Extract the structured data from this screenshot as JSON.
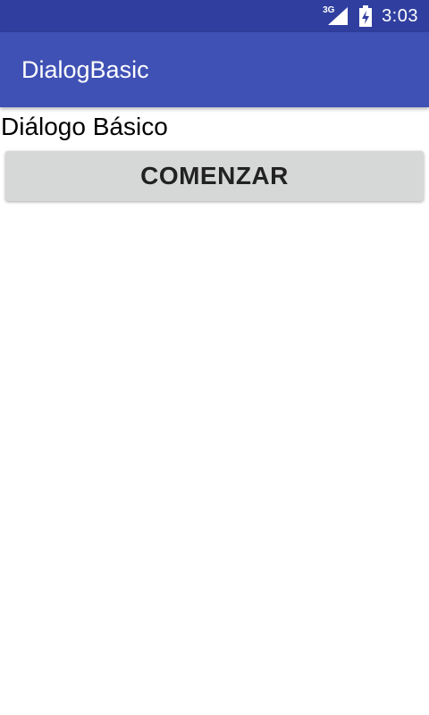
{
  "status_bar": {
    "network_type": "3G",
    "time": "3:03",
    "icons": [
      "signal-icon",
      "battery-charging-icon"
    ],
    "background_color": "#303F9F"
  },
  "app_bar": {
    "title": "DialogBasic",
    "background_color": "#3F51B5"
  },
  "main": {
    "heading": "Diálogo Básico",
    "start_button_label": "COMENZAR",
    "button_color": "#D6D7D7"
  }
}
